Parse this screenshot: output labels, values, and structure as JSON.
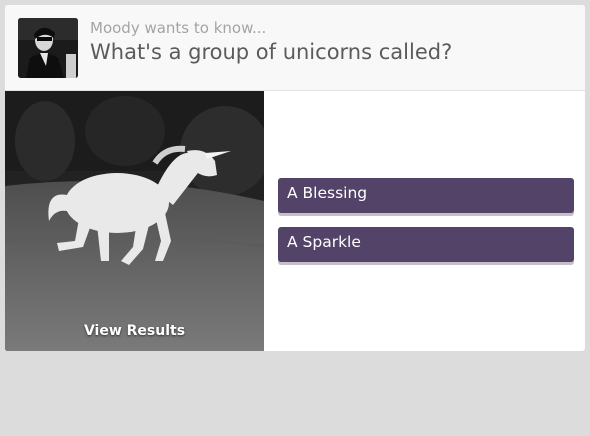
{
  "poll": {
    "asker_text": "Moody wants to know...",
    "question": "What's a group of unicorns called?",
    "view_results_label": "View Results",
    "answers": [
      {
        "label": "A Blessing"
      },
      {
        "label": "A Sparkle"
      }
    ]
  },
  "theme": {
    "answer_button_color": "#544369",
    "background": "#dcdcdc"
  }
}
